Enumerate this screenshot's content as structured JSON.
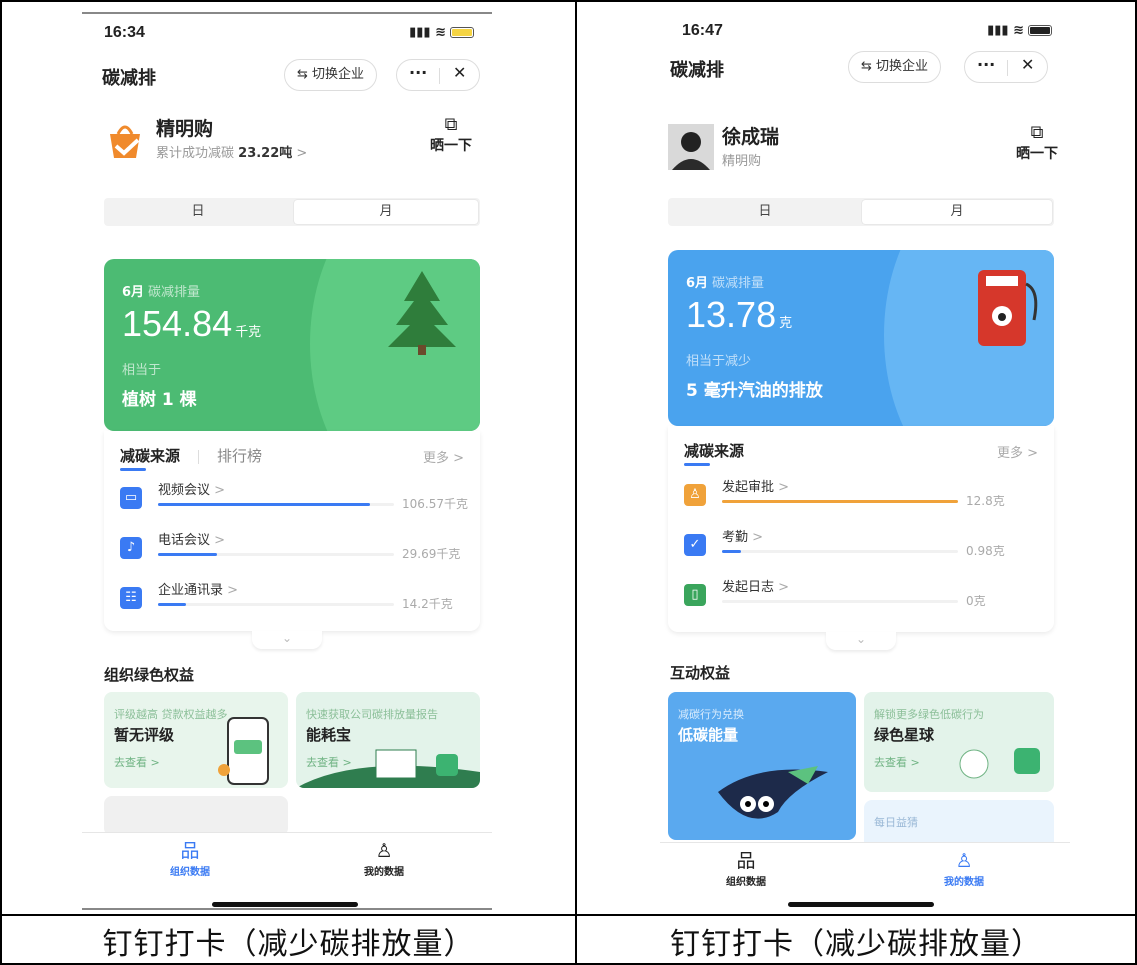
{
  "captions": {
    "left": "钉钉打卡（减少碳排放量）",
    "right": "钉钉打卡（减少碳排放量）"
  },
  "left": {
    "status_time": "16:34",
    "page_title": "碳减排",
    "switch_label": "⇆ 切换企业",
    "capsule_more": "···",
    "capsule_close": "✕",
    "profile_name": "精明购",
    "profile_sub_prefix": "累计成功减碳",
    "profile_sub_value": "23.22吨",
    "profile_sub_arrow": ">",
    "share_icon": "external-link-icon",
    "share_label": "晒一下",
    "toggle_day": "日",
    "toggle_month": "月",
    "toggle_selected": "月",
    "hero_month": "6月",
    "hero_metric": "碳减排量",
    "hero_value": "154.84",
    "hero_unit": "千克",
    "hero_equiv_label": "相当于",
    "hero_equiv": "植树 1 棵",
    "tab_sources": "减碳来源",
    "tab_ranking": "排行榜",
    "more": "更多 >",
    "rows": [
      {
        "label": "视频会议",
        "arrow": ">",
        "value": "106.57千克",
        "fraction": 0.9,
        "icon": "video-icon",
        "color": "#3a7af3"
      },
      {
        "label": "电话会议",
        "arrow": ">",
        "value": "29.69千克",
        "fraction": 0.25,
        "icon": "microphone-icon",
        "color": "#3a7af3"
      },
      {
        "label": "企业通讯录",
        "arrow": ">",
        "value": "14.2千克",
        "fraction": 0.12,
        "icon": "contacts-icon",
        "color": "#3a7af3"
      }
    ],
    "section_title": "组织绿色权益",
    "card1_sub": "评级越高 贷款权益越多",
    "card1_title": "暂无评级",
    "card1_link": "去查看 >",
    "card2_sub": "快速获取公司碳排放量报告",
    "card2_title": "能耗宝",
    "card2_link": "去查看 >",
    "tab_org": "组织数据",
    "tab_mine": "我的数据",
    "active_tab": "组织数据",
    "hero_color": "#4cbb73",
    "hero_curve": "#5ecb83"
  },
  "right": {
    "status_time": "16:47",
    "page_title": "碳减排",
    "switch_label": "⇆ 切换企业",
    "capsule_more": "···",
    "capsule_close": "✕",
    "profile_name": "徐成瑞",
    "profile_sub": "精明购",
    "share_icon": "external-link-icon",
    "share_label": "晒一下",
    "toggle_day": "日",
    "toggle_month": "月",
    "toggle_selected": "月",
    "hero_month": "6月",
    "hero_metric": "碳减排量",
    "hero_value": "13.78",
    "hero_unit": "克",
    "hero_equiv_label": "相当于减少",
    "hero_equiv": "5 毫升汽油的排放",
    "tab_sources": "减碳来源",
    "more": "更多 >",
    "rows": [
      {
        "label": "发起审批",
        "arrow": ">",
        "value": "12.8克",
        "fraction": 1.0,
        "icon": "stamp-icon",
        "color": "#f0a23a"
      },
      {
        "label": "考勤",
        "arrow": ">",
        "value": "0.98克",
        "fraction": 0.08,
        "icon": "shield-check-icon",
        "color": "#3a7af3"
      },
      {
        "label": "发起日志",
        "arrow": ">",
        "value": "0克",
        "fraction": 0.0,
        "icon": "log-book-icon",
        "color": "#3aa55c"
      }
    ],
    "section_title": "互动权益",
    "card1_sub": "减碳行为兑换",
    "card1_title": "低碳能量",
    "card2_sub": "解锁更多绿色低碳行为",
    "card2_title": "绿色星球",
    "card2_link": "去查看 >",
    "card3_sub": "每日益猜",
    "tab_org": "组织数据",
    "tab_mine": "我的数据",
    "active_tab": "我的数据",
    "hero_color": "#4aa3ee",
    "hero_curve": "#66b6f4"
  }
}
